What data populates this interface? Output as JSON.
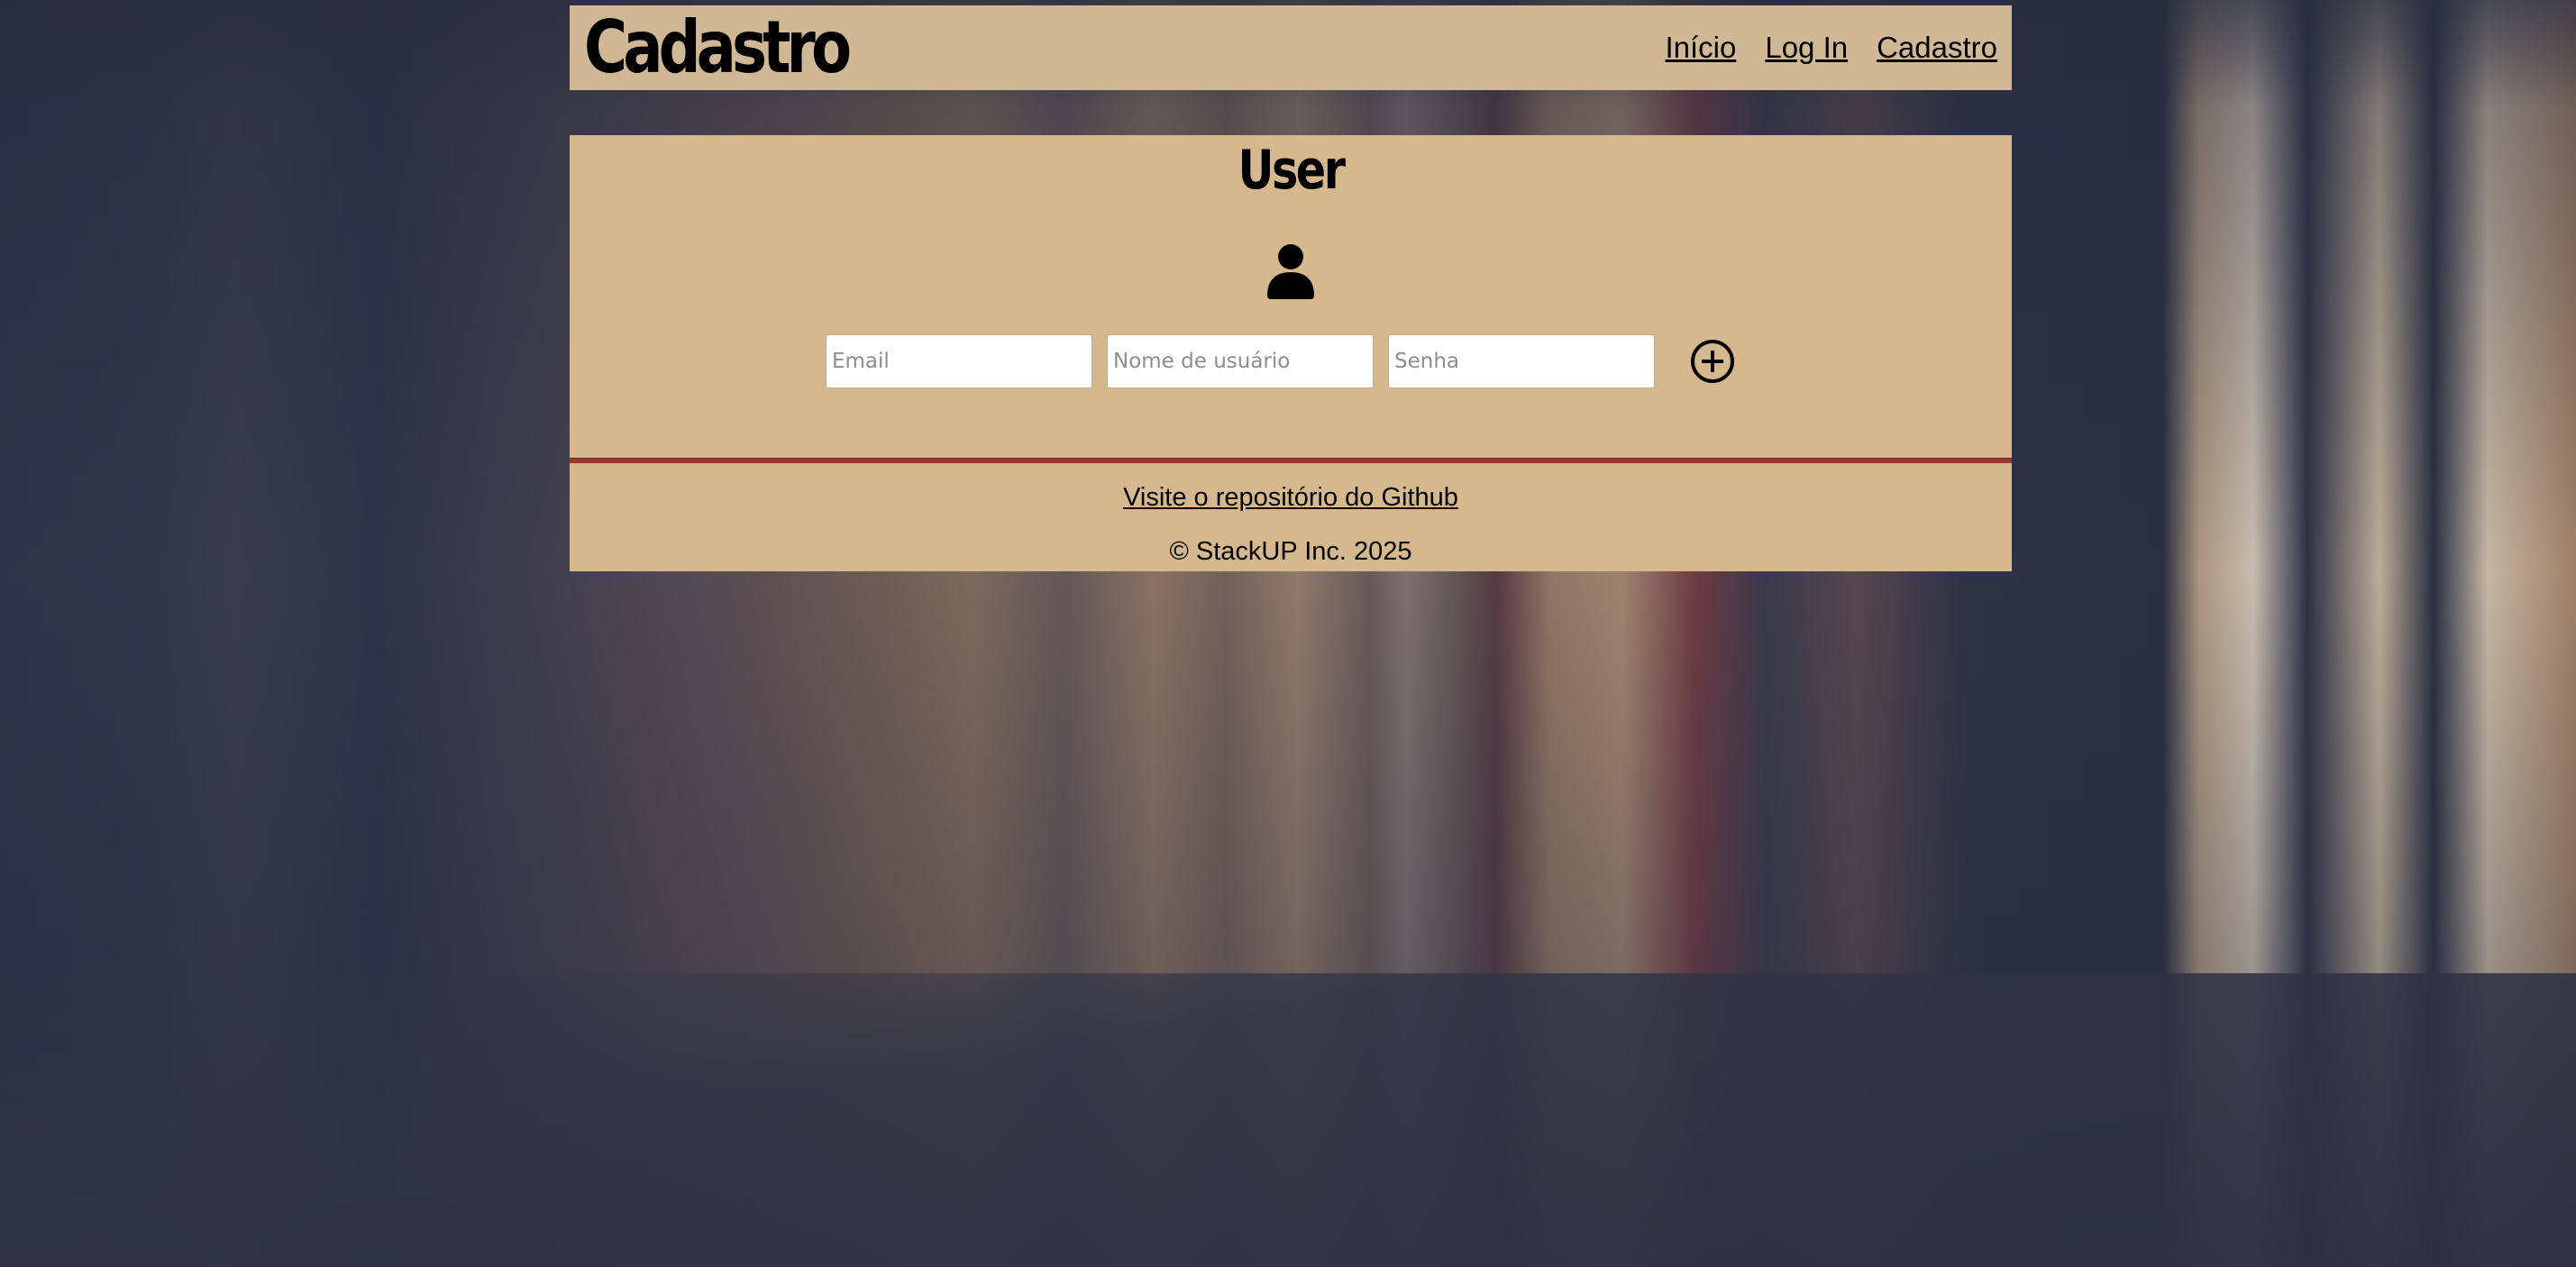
{
  "header": {
    "brand": "Cadastro",
    "nav": [
      {
        "label": "Início"
      },
      {
        "label": "Log In"
      },
      {
        "label": "Cadastro"
      }
    ]
  },
  "card": {
    "title": "User",
    "icon": "user-icon",
    "fields": {
      "email_placeholder": "Email",
      "username_placeholder": "Nome de usuário",
      "password_placeholder": "Senha"
    },
    "add_icon": "plus-circle-icon"
  },
  "footer": {
    "repo_link": "Visite o repositório do Github",
    "copyright": "© StackUP Inc. 2025"
  },
  "colors": {
    "header_bg": "#d0b896",
    "panel_bg": "#d6b88e",
    "divider": "#9a3a2e"
  }
}
